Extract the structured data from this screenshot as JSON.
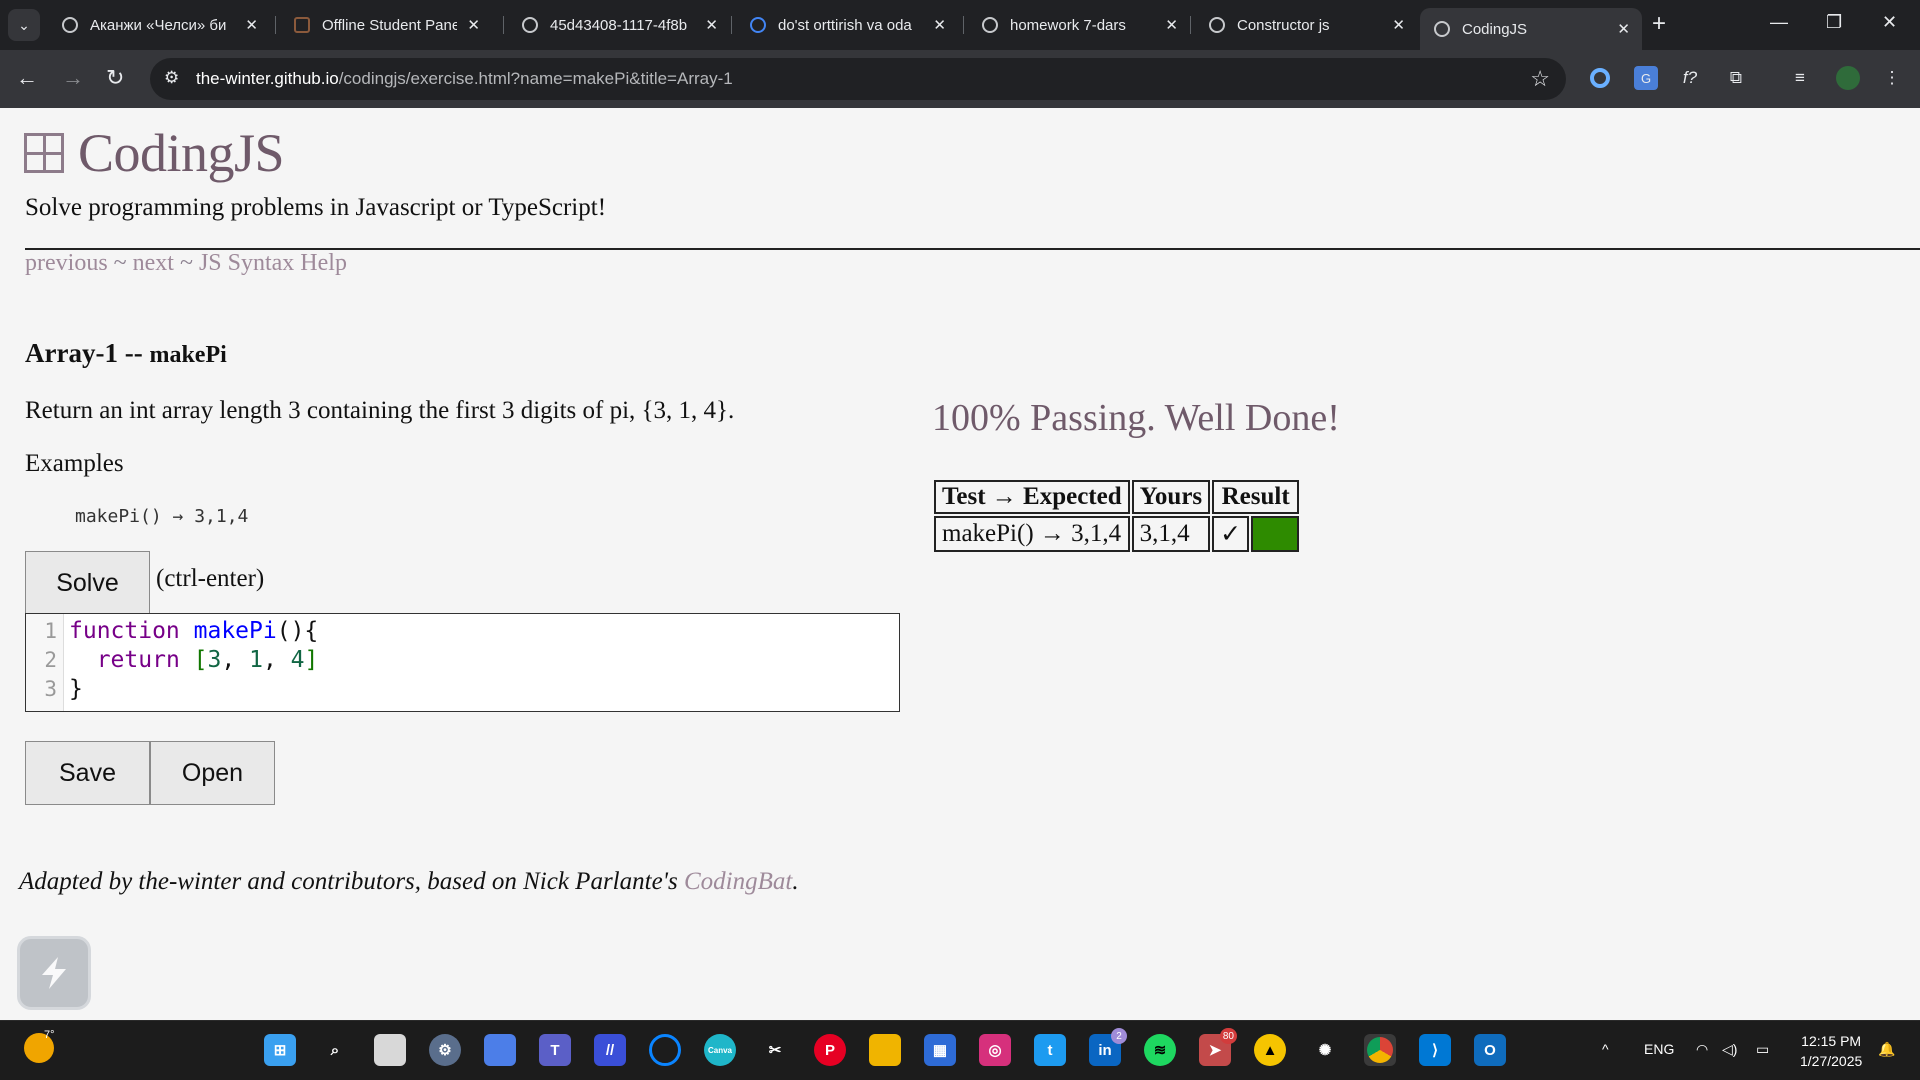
{
  "browser": {
    "tabs": [
      {
        "title": "Аканжи «Челси» би",
        "active": false
      },
      {
        "title": "Offline Student Panel",
        "active": false
      },
      {
        "title": "45d43408-1117-4f8b",
        "active": false
      },
      {
        "title": "do'st orttirish va oda",
        "active": false
      },
      {
        "title": "homework 7-dars",
        "active": false
      },
      {
        "title": "Constructor js",
        "active": false
      },
      {
        "title": "CodingJS",
        "active": true
      }
    ],
    "new_tab_label": "+",
    "url_host": "the-winter.github.io",
    "url_path": "/codingjs/exercise.html?name=makePi&title=Array-1"
  },
  "page": {
    "site_title": "CodingJS",
    "subtitle": "Solve programming problems in Javascript or TypeScript!",
    "nav": {
      "previous": "previous",
      "next": "next",
      "help": "JS Syntax Help",
      "sep": " ~ "
    },
    "exercise": {
      "category": "Array-1 -- ",
      "name": "makePi"
    },
    "description": "Return an int array length 3 containing the first 3 digits of pi, {3, 1, 4}.",
    "examples_label": "Examples",
    "example": "makePi() → 3,1,4",
    "solve_button": "Solve",
    "solve_hint": "(ctrl-enter)",
    "code": {
      "line_numbers": [
        "1",
        "2",
        "3"
      ],
      "line1_kw": "function",
      "line1_def": "makePi",
      "line1_rest": "(){",
      "line2_kw": "return",
      "line2_open": "[",
      "line2_n1": "3",
      "line2_n2": "1",
      "line2_n3": "4",
      "line2_close": "]",
      "line3": "}"
    },
    "save_button": "Save",
    "open_button": "Open",
    "pass_message": "100% Passing. Well Done!",
    "results": {
      "headers": [
        "Test → Expected",
        "Yours",
        "Result"
      ],
      "rows": [
        {
          "test": "makePi() → 3,1,4",
          "yours": "3,1,4",
          "result": "✓",
          "status_color": "#2e8b00"
        }
      ]
    },
    "footer": {
      "text": "Adapted by the-winter and contributors, based on Nick Parlante's ",
      "link": "CodingBat",
      "end": "."
    }
  },
  "taskbar": {
    "weather_temp": "7°",
    "language": "ENG",
    "time": "12:15 PM",
    "date": "1/27/2025",
    "linkedin_badge": "2",
    "telegram_badge": "80"
  }
}
